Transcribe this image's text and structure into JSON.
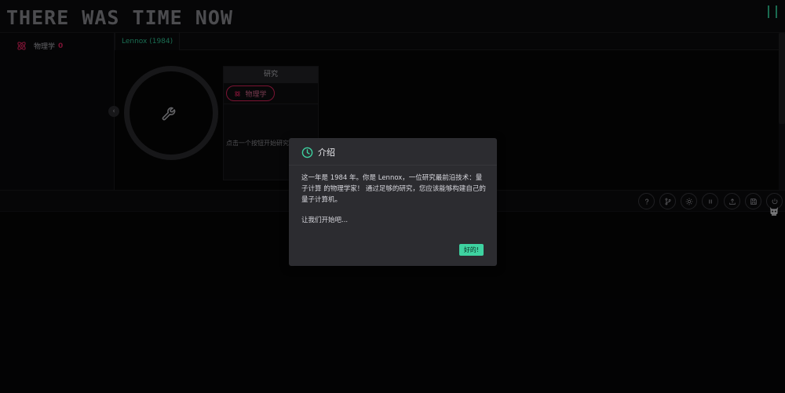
{
  "header": {
    "title": "THERE WAS TIME NOW",
    "pause_icon": "pause-icon",
    "accent_color": "#30c494"
  },
  "sidebar": {
    "items": [
      {
        "label": "物理学",
        "count": "0",
        "icon": "atom-icon",
        "color": "#e0245e"
      }
    ]
  },
  "tabs": [
    {
      "label": "Lennox (1984)"
    }
  ],
  "character": {
    "icon": "wrench-icon"
  },
  "research": {
    "header": "研究",
    "pill_label": "物理学",
    "hint": "点击一个按钮开始研究"
  },
  "toolbar": {
    "buttons": [
      {
        "icon": "help-icon"
      },
      {
        "icon": "branch-icon"
      },
      {
        "icon": "sun-icon"
      },
      {
        "icon": "pause-icon"
      },
      {
        "icon": "upload-icon"
      },
      {
        "icon": "save-icon"
      },
      {
        "icon": "power-icon"
      }
    ]
  },
  "modal": {
    "title": "介绍",
    "icon": "clock-icon",
    "paragraph1": "这一年是 1984 年。你是 Lennox，一位研究最前沿技术：量子计算 的物理学家！ 通过足够的研究，您应该能够构建自己的量子计算机。",
    "paragraph2": "让我们开始吧...",
    "ok_label": "好的!",
    "ok_color": "#3ed2a0"
  }
}
